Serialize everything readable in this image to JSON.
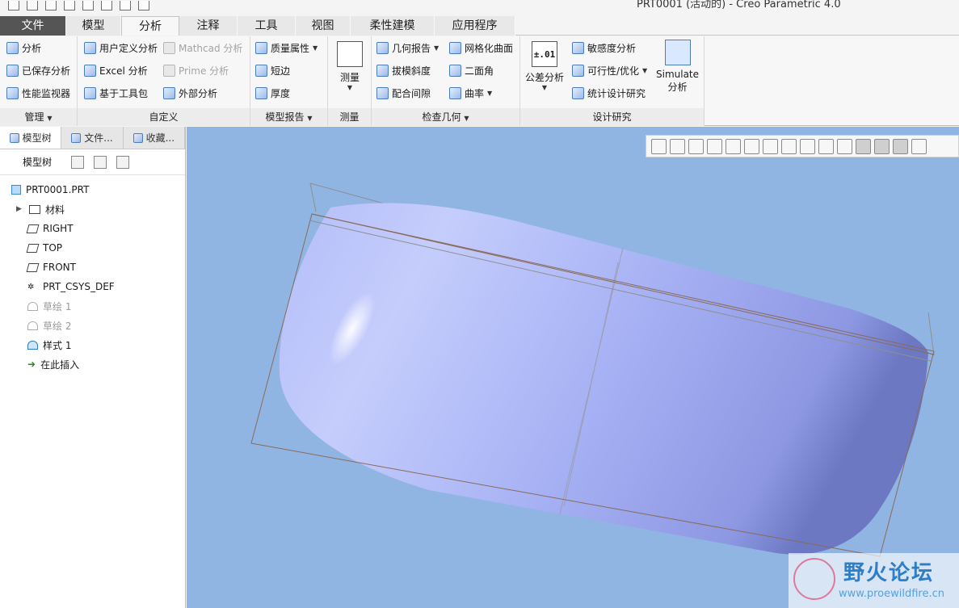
{
  "window": {
    "title": "PRT0001 (活动的) - Creo Parametric 4.0"
  },
  "tabs": [
    "文件",
    "模型",
    "分析",
    "注释",
    "工具",
    "视图",
    "柔性建模",
    "应用程序"
  ],
  "active_tab": "分析",
  "ribbon": {
    "groups": {
      "manage": {
        "label": "管理",
        "items": [
          "分析",
          "已保存分析",
          "性能监视器"
        ]
      },
      "custom": {
        "label": "自定义",
        "items": [
          "用户定义分析",
          "Mathcad 分析",
          "Excel 分析",
          "Prime 分析",
          "基于工具包",
          "外部分析"
        ]
      },
      "model_report": {
        "label": "模型报告",
        "items": [
          "质量属性",
          "短边",
          "厚度"
        ]
      },
      "measure": {
        "label": "测量",
        "button": "测量"
      },
      "inspect": {
        "label": "检查几何",
        "items": [
          "几何报告",
          "网格化曲面",
          "拔模斜度",
          "二面角",
          "配合间隙",
          "曲率"
        ]
      },
      "design_study": {
        "label": "设计研究",
        "tolerance_label": "公差分析",
        "tolerance_icon_text": "±.01",
        "items": [
          "敏感度分析",
          "可行性/优化",
          "统计设计研究"
        ],
        "simulate_line1": "Simulate",
        "simulate_line2": "分析"
      }
    }
  },
  "panel": {
    "tabs": [
      "模型树",
      "文件...",
      "收藏..."
    ],
    "tree_header": "模型树",
    "tree": [
      {
        "label": "PRT0001.PRT",
        "kind": "root"
      },
      {
        "label": "材料",
        "kind": "material"
      },
      {
        "label": "RIGHT",
        "kind": "plane"
      },
      {
        "label": "TOP",
        "kind": "plane"
      },
      {
        "label": "FRONT",
        "kind": "plane"
      },
      {
        "label": "PRT_CSYS_DEF",
        "kind": "csys"
      },
      {
        "label": "草绘 1",
        "kind": "sketch"
      },
      {
        "label": "草绘 2",
        "kind": "sketch"
      },
      {
        "label": "样式 1",
        "kind": "style"
      },
      {
        "label": "在此插入",
        "kind": "insert"
      }
    ]
  },
  "watermark": {
    "title": "野火论坛",
    "url": "www.proewildfire.cn"
  },
  "colors": {
    "viewport_bg": "#90b5e3",
    "part_surface": "#a8b3f5",
    "file_tab": "#555555",
    "datum_line": "#8a6a5a"
  }
}
